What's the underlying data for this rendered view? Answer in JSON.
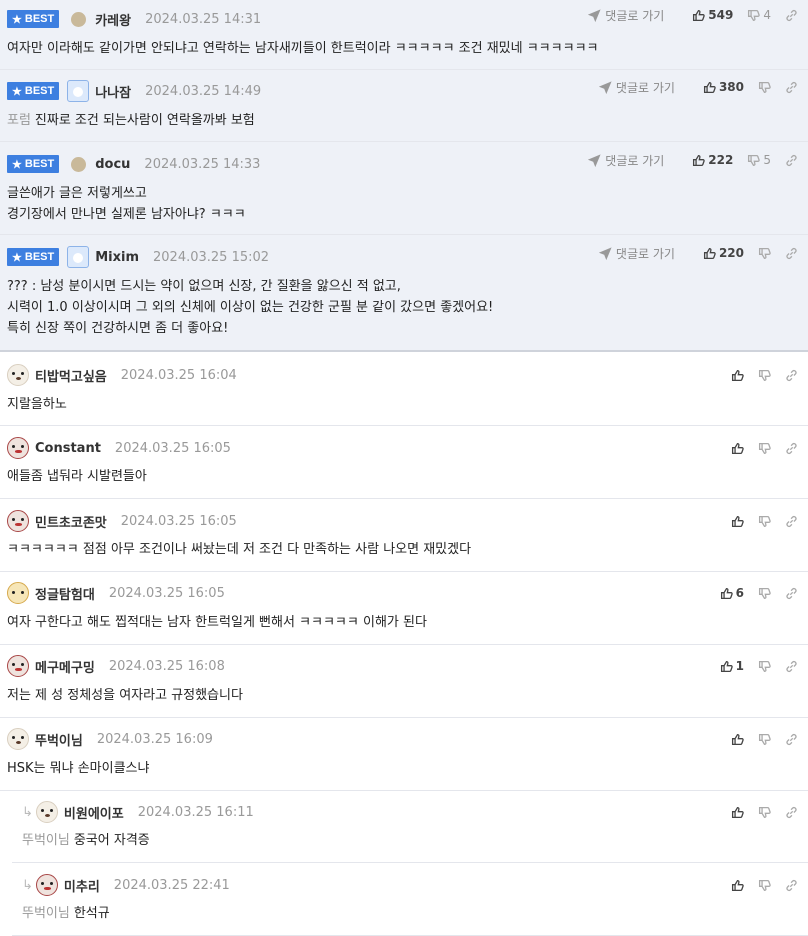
{
  "reply_label": "댓글로 가기",
  "best_label": "BEST",
  "comments": [
    {
      "best": true,
      "avatar": "dot",
      "nick": "카레왕",
      "date": "2024.03.25 14:31",
      "reply": true,
      "up": "549",
      "down": "4",
      "quote": "",
      "lines": [
        "여자만 이라해도 같이가면 안되냐고 연락하는 남자새끼들이 한트럭이라 ㅋㅋㅋㅋㅋ 조건 재밌네 ㅋㅋㅋㅋㅋㅋ"
      ]
    },
    {
      "best": true,
      "avatar": "blue",
      "nick": "나나잠",
      "date": "2024.03.25 14:49",
      "reply": true,
      "up": "380",
      "down": "",
      "quote": "포럼",
      "lines": [
        "진짜로 조건 되는사람이 연락올까봐 보험"
      ]
    },
    {
      "best": true,
      "avatar": "dot",
      "nick": "docu",
      "date": "2024.03.25 14:33",
      "reply": true,
      "up": "222",
      "down": "5",
      "quote": "",
      "lines": [
        "글쓴애가 글은 저렇게쓰고",
        "경기장에서 만나면 실제론 남자아냐? ㅋㅋㅋ"
      ]
    },
    {
      "best": true,
      "avatar": "blue",
      "nick": "Mixim",
      "date": "2024.03.25 15:02",
      "reply": true,
      "up": "220",
      "down": "",
      "quote": "",
      "lines": [
        "??? : 남성 분이시면 드시는 약이 없으며 신장, 간 질환을 앓으신 적 없고,",
        "시력이 1.0 이상이시며 그 외의 신체에 이상이 없는 건강한 군필 분 같이 갔으면 좋겠어요!",
        "특히 신장 쪽이 건강하시면 좀 더 좋아요!"
      ]
    },
    {
      "best": false,
      "avatar": "pup",
      "nick": "티밥먹고싶음",
      "date": "2024.03.25 16:04",
      "reply": false,
      "up": "",
      "down": "",
      "quote": "",
      "lines": [
        "지랄을하노"
      ]
    },
    {
      "best": false,
      "avatar": "red",
      "nick": "Constant",
      "date": "2024.03.25 16:05",
      "reply": false,
      "up": "",
      "down": "",
      "quote": "",
      "lines": [
        "애들좀 냅둬라 시발련들아"
      ]
    },
    {
      "best": false,
      "avatar": "red",
      "nick": "민트초코존맛",
      "date": "2024.03.25 16:05",
      "reply": false,
      "up": "",
      "down": "",
      "quote": "",
      "lines": [
        "ㅋㅋㅋㅋㅋㅋ 점점 아무 조건이나 써놨는데 저 조건 다 만족하는 사람 나오면 재밌겠다"
      ]
    },
    {
      "best": false,
      "avatar": "fox",
      "nick": "정글탐험대",
      "date": "2024.03.25 16:05",
      "reply": false,
      "up": "6",
      "down": "",
      "quote": "",
      "lines": [
        "여자 구한다고 해도 찝적대는 남자 한트럭일게 뻔해서 ㅋㅋㅋㅋㅋ 이해가 된다"
      ]
    },
    {
      "best": false,
      "avatar": "red",
      "nick": "메구메구밍",
      "date": "2024.03.25 16:08",
      "reply": false,
      "up": "1",
      "down": "",
      "quote": "",
      "lines": [
        "저는 제 성 정체성을 여자라고 규정했습니다"
      ]
    },
    {
      "best": false,
      "avatar": "pup",
      "nick": "뚜벅이님",
      "date": "2024.03.25 16:09",
      "reply": false,
      "up": "",
      "down": "",
      "quote": "",
      "lines": [
        "HSK는 뭐냐 손마이클스냐"
      ]
    },
    {
      "best": false,
      "avatar": "pup",
      "nick": "비원에이포",
      "date": "2024.03.25 16:11",
      "reply": false,
      "up": "",
      "down": "",
      "quote": "뚜벅이님",
      "lines": [
        "중국어 자격증"
      ],
      "nested": true
    },
    {
      "best": false,
      "avatar": "red",
      "nick": "미추리",
      "date": "2024.03.25 22:41",
      "reply": false,
      "up": "",
      "down": "",
      "quote": "뚜벅이님",
      "lines": [
        "한석규"
      ],
      "nested": true
    }
  ]
}
